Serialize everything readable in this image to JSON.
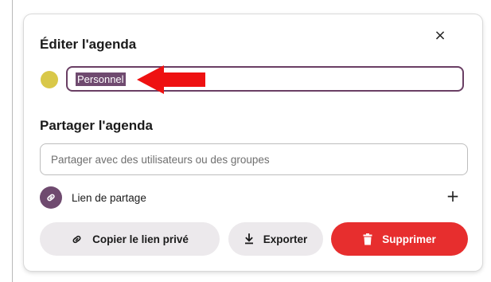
{
  "dialog": {
    "edit_title": "Éditer l'agenda",
    "close_label": "×",
    "calendar_color": "#d9c849",
    "calendar_name": "Personnel",
    "share_title": "Partager l'agenda",
    "share_placeholder": "Partager avec des utilisateurs ou des groupes",
    "share_link": {
      "label": "Lien de partage",
      "add_label": "+",
      "icon": "link-icon"
    },
    "buttons": {
      "copy_private_link": "Copier le lien privé",
      "export": "Exporter",
      "delete": "Supprimer"
    }
  },
  "annotation": {
    "arrow_color": "#ee1111",
    "points_to": "calendar-name-input"
  },
  "colors": {
    "accent": "#6f4a6f",
    "danger": "#e72e2e",
    "secondary_button": "#ece9ec"
  }
}
